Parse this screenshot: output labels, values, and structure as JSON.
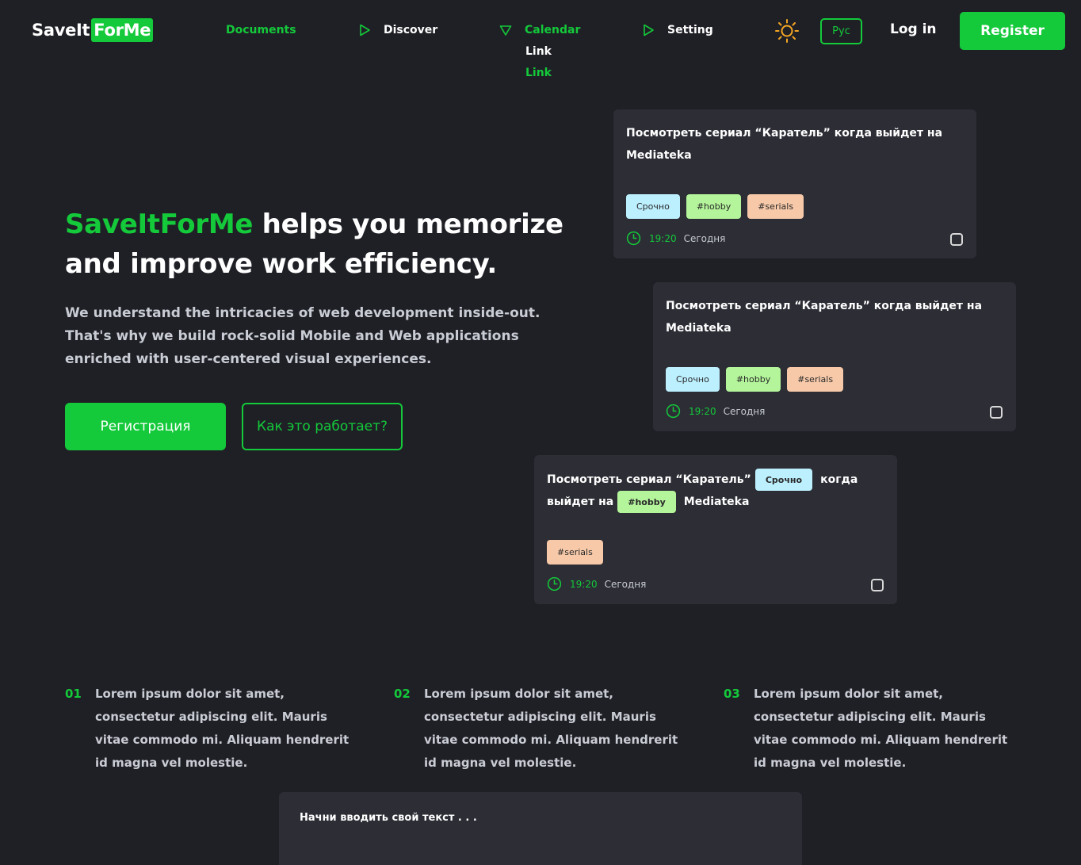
{
  "brand": {
    "part1": "SaveIt",
    "part2": "ForMe"
  },
  "nav": {
    "items": [
      {
        "label": "Documents"
      },
      {
        "label": "Discover"
      },
      {
        "label": "Calendar"
      },
      {
        "label": "Setting"
      }
    ],
    "calendar_sub": [
      "Link",
      "Link"
    ],
    "theme_icon": "sun-icon",
    "language": "Рус",
    "login": "Log in",
    "register": "Register"
  },
  "hero": {
    "title_accent": "SaveItForMe",
    "title_rest": "helps you memorize and improve work efficiency.",
    "description": "We understand the intricacies of web development inside-out. That's why we build rock-solid Mobile and Web applications enriched with user-centered visual experiences.",
    "primary_button": "Регистрация",
    "secondary_button": "Как это работает?"
  },
  "cards": [
    {
      "title": "Посмотреть сериал “Каратель” когда выйдет на Mediateka",
      "tags": [
        "Срочно",
        "#hobby",
        "#serials"
      ],
      "time": "19:20",
      "day": "Сегодня"
    },
    {
      "title": "Посмотреть сериал “Каратель” когда выйдет на Mediateka",
      "tags": [
        "Срочно",
        "#hobby",
        "#serials"
      ],
      "time": "19:20",
      "day": "Сегодня"
    },
    {
      "line1_before": "Посмотреть сериал “Каратель”",
      "line1_after": "когда",
      "line2_before": "выйдет на",
      "line2_after": "Mediateka",
      "tags": [
        "Срочно",
        "#hobby",
        "#serials"
      ],
      "time": "19:20",
      "day": "Сегодня"
    }
  ],
  "features": [
    {
      "num": "01",
      "text": "Lorem ipsum dolor sit amet, consectetur adipiscing elit. Mauris vitae commodo mi. Aliquam hendrerit id magna vel molestie."
    },
    {
      "num": "02",
      "text": "Lorem ipsum dolor sit amet, consectetur adipiscing elit. Mauris vitae commodo mi. Aliquam hendrerit id magna vel molestie."
    },
    {
      "num": "03",
      "text": "Lorem ipsum dolor sit amet, consectetur adipiscing elit. Mauris vitae commodo mi. Aliquam hendrerit id magna vel molestie."
    }
  ],
  "note_input": {
    "placeholder": "Начни вводить свой текст . . ."
  },
  "colors": {
    "accent": "#14c93a",
    "background": "#1f2026",
    "card": "#2c2d35",
    "tag_urgent": "#bdf0ff",
    "tag_hobby": "#b4f59b",
    "tag_serials": "#f7c9a9"
  }
}
